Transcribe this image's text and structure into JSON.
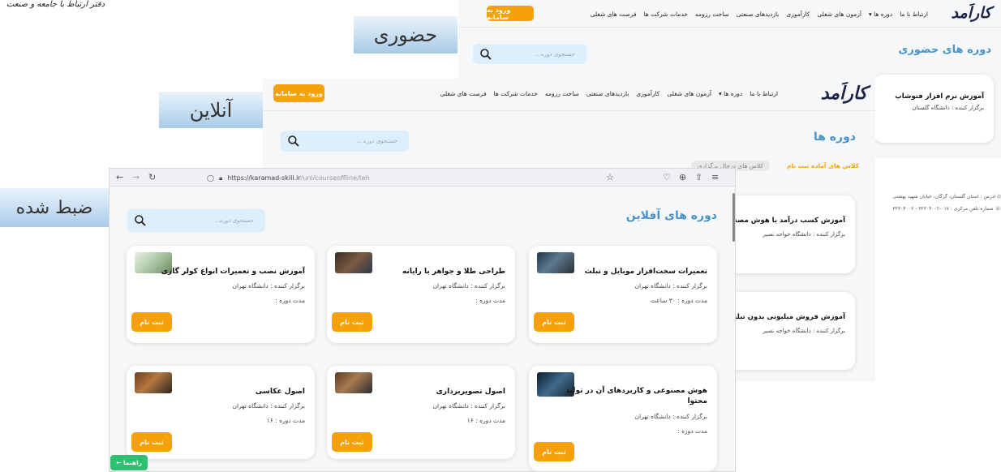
{
  "slogan": "دفتر ارتباط با جامعه و صنعت",
  "labels": {
    "hozoori": "حضوری",
    "online": "آنلاین",
    "recorded": "ضبط شده"
  },
  "logo_text": "کاراَمد",
  "top_window": {
    "login_button": "ورود به سامانه",
    "menu": [
      "ارتباط با ما",
      "دوره ها ▾",
      "آزمون های شغلی",
      "کارآموزی",
      "بازدیدهای صنعتی",
      "ساخت رزومه",
      "خدمات شرکت ها",
      "فرصت های شغلی"
    ],
    "search_placeholder": "جستجوی دوره...",
    "page_title": "دوره های حضوری",
    "card": {
      "title": "آموزش نرم افزار فتوشاپ",
      "organizer": "برگزار کننده : دانشگاه گلستان"
    }
  },
  "middle_window": {
    "login_button": "ورود به سامانه",
    "menu": [
      "ارتباط با ما",
      "دوره ها ▾",
      "آزمون های شغلی",
      "کارآموزی",
      "بازدیدهای صنعتی",
      "ساخت رزومه",
      "خدمات شرکت ها",
      "فرصت های شغلی"
    ],
    "search_placeholder": "جستجوی دوره ...",
    "page_title": "دوره ها",
    "tab_ready": "کلاس های آماده ثبت نام",
    "tab_running": "کلاس های درحال برگزاری",
    "footer_address": "آدرس : استان گلستان، گرگان، خیابان شهید بهشتی",
    "footer_phone": "شماره تلفن مرکزی : ۰۱۷-۳۲۳۰۴۰۰۲ - ۳۲۳۰۴۰۰۲",
    "cards": [
      {
        "title": "آموزش کسب درآمد با هوش مصنوعی",
        "organizer": "برگزار کننده : دانشگاه خواجه نصیر"
      },
      {
        "title": "آموزش فروش میلیونی بدون تبلیغات",
        "organizer": "برگزار کننده : دانشگاه خواجه نصیر"
      }
    ]
  },
  "browser": {
    "url_domain": "https://karamad-skill.ir",
    "url_path": "/uni/courseoffline/teh",
    "search_placeholder": "جستجوی دوره...",
    "page_title": "دوره های آفلاین",
    "register_label": "ثبت نام",
    "cards": [
      {
        "title": "تعمیرات سخت‌افزار موبایل و تبلت",
        "organizer": "برگزار کننده : دانشگاه تهران",
        "duration": "مدت دوره : ۳۰ ساعت"
      },
      {
        "title": "طراحی طلا و جواهر با رایانه",
        "organizer": "برگزار کننده : دانشگاه تهران",
        "duration": "مدت دوره :"
      },
      {
        "title": "آموزش نصب و تعمیرات انواع کولر گازی",
        "organizer": "برگزار کننده : دانشگاه تهران",
        "duration": "مدت دوره :"
      },
      {
        "title": "هوش مصنوعی و کاربردهای آن در تولید",
        "title2": "محتوا",
        "organizer": "برگزار کننده : دانشگاه تهران",
        "duration": "مدت دوره :"
      },
      {
        "title": "اصول تصویربرداری",
        "organizer": "برگزار کننده : دانشگاه تهران",
        "duration": "مدت دوره : ۱۶"
      },
      {
        "title": "اصول عکاسی",
        "organizer": "برگزار کننده : دانشگاه تهران",
        "duration": "مدت دوره : ۱۶"
      }
    ]
  },
  "help_button": "راهنما ←",
  "colors": {
    "accent_orange": "#f5a20a",
    "title_blue": "#4a93c9",
    "help_green": "#2fbf71",
    "search_bg": "#ddeefc"
  }
}
